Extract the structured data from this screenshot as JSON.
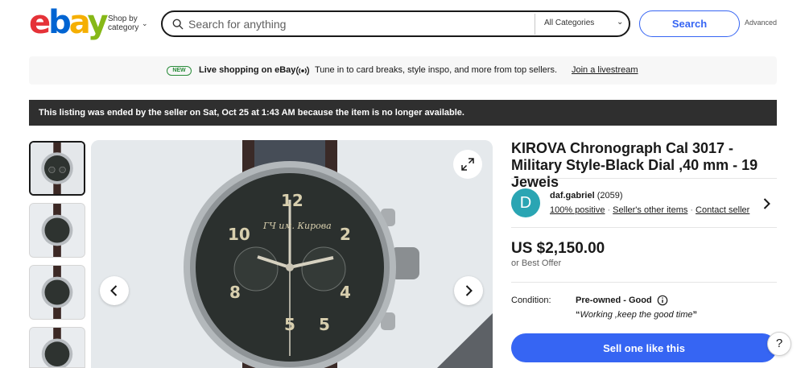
{
  "header": {
    "logo": {
      "e": "e",
      "b": "b",
      "a": "a",
      "y": "y"
    },
    "shop_by_line1": "Shop by",
    "shop_by_line2": "category",
    "search_placeholder": "Search for anything",
    "category_selected": "All Categories",
    "search_button": "Search",
    "advanced_link": "Advanced"
  },
  "live_banner": {
    "badge": "NEW",
    "title": "Live shopping on eBay",
    "description": "Tune in to card breaks, style inspo, and more from top sellers.",
    "link": "Join a livestream"
  },
  "ended_notice": "This listing was ended by the seller on Sat, Oct 25 at 1:43 AM because the item is no longer available.",
  "listing": {
    "title": "KIROVA Chronograph Cal 3017 - Military Style-Black Dial ,40 mm - 19 Jewels",
    "seller": {
      "avatar_letter": "D",
      "name": "daf.gabriel",
      "feedback_count": "(2059)",
      "positive": "100% positive",
      "other_items": "Seller's other items",
      "contact": "Contact seller"
    },
    "price": "US $2,150.00",
    "best_offer": "or Best Offer",
    "condition_label": "Condition:",
    "condition_value": "Pre-owned - Good",
    "condition_note_open": "“",
    "condition_note": "Working ,keep the good time",
    "condition_note_close": "”",
    "sell_button": "Sell one like this",
    "help_button": "?"
  },
  "colors": {
    "accent": "#3665f3",
    "ended_bg": "#2f2f2f",
    "avatar_bg": "#2aa5b3"
  }
}
